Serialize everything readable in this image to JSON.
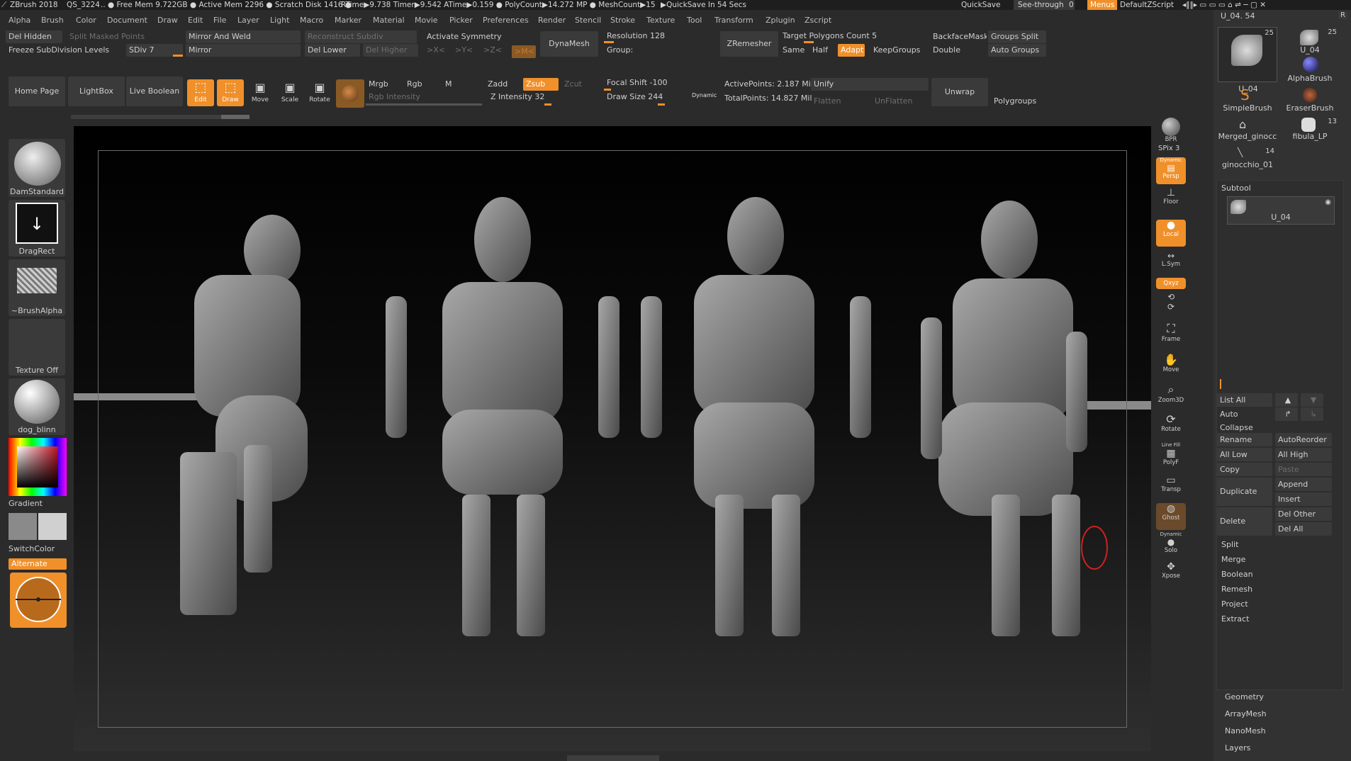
{
  "titlebar": {
    "app": "ZBrush 2018",
    "qs": "QS_3224",
    "stats": ".. ● Free Mem 9.722GB ● Active Mem 2296 ● Scratch Disk 1416 ●",
    "rtime": "RTime▶9.738 Timer▶9.542 ATime▶0.159 ● PolyCount▶14.272 MP ● MeshCount▶15",
    "autosave": "▶QuickSave In 54 Secs",
    "quicksave": "QuickSave",
    "see_through": "See-through",
    "see_through_value": "0",
    "menus": "Menus",
    "zscript": "DefaultZScript"
  },
  "menubar": [
    "Alpha",
    "Brush",
    "Color",
    "Document",
    "Draw",
    "Edit",
    "File",
    "Layer",
    "Light",
    "Macro",
    "Marker",
    "Material",
    "Movie",
    "Picker",
    "Preferences",
    "Render",
    "Stencil",
    "Stroke",
    "Texture",
    "Tool",
    "Transform",
    "Zplugin",
    "Zscript"
  ],
  "toolbar": {
    "del_hidden": "Del Hidden",
    "split_masked": "Split Masked Points",
    "mirror_weld": "Mirror And Weld",
    "reconstruct": "Reconstruct Subdiv",
    "activate_symmetry": "Activate Symmetry",
    "dynamesh": "DynaMesh",
    "resolution": "Resolution 128",
    "group": "Group:",
    "zremesher": "ZRemesher",
    "target_poly": "Target Polygons Count 5",
    "same": "Same",
    "half": "Half",
    "adapt": "Adapt",
    "keepgroups": "KeepGroups",
    "backface": "BackfaceMask",
    "groups_split": "Groups Split",
    "double": "Double",
    "auto_groups": "Auto Groups",
    "freeze": "Freeze SubDivision Levels",
    "sdiv": "SDiv 7",
    "mirror": "Mirror",
    "del_lower": "Del Lower",
    "del_higher": "Del Higher",
    "x": ">X<",
    "y": ">Y<",
    "z": ">Z<",
    "m": ">M<",
    "home": "Home Page",
    "lightbox": "LightBox",
    "live_boolean": "Live Boolean",
    "edit": "Edit",
    "draw": "Draw",
    "move": "Move",
    "scale": "Scale",
    "rotate": "Rotate",
    "mrgb": "Mrgb",
    "rgb": "Rgb",
    "m_btn": "M",
    "zadd": "Zadd",
    "zsub": "Zsub",
    "zcut": "Zcut",
    "rgb_intensity": "Rgb Intensity",
    "z_intensity": "Z Intensity 32",
    "focal_shift": "Focal Shift -100",
    "draw_size": "Draw Size 244",
    "dynamic": "Dynamic",
    "active_points": "ActivePoints: 2.187 Mil",
    "total_points": "TotalPoints: 14.827 Mil",
    "unify": "Unify",
    "flatten": "Flatten",
    "unflatten": "UnFlatten",
    "unwrap": "Unwrap",
    "polygroups": "Polygroups"
  },
  "left": {
    "brush": "DamStandard",
    "stroke": "DragRect",
    "alpha": "~BrushAlpha",
    "texture": "Texture Off",
    "material": "dog_blinn",
    "gradient": "Gradient",
    "switchcolor": "SwitchColor",
    "alternate": "Alternate"
  },
  "rightshelf": {
    "bpr": "BPR",
    "spix": "SPix 3",
    "dynamic": "Dynamic",
    "persp": "Persp",
    "floor": "Floor",
    "local": "Local",
    "lsym": "L.Sym",
    "xyz": "Qxyz",
    "frame": "Frame",
    "move": "Move",
    "zoom3d": "Zoom3D",
    "rotate": "Rotate",
    "polyf": "PolyF",
    "linefill": "Line Fill",
    "transp": "Transp",
    "ghost": "Ghost",
    "solo": "Solo",
    "dynamic2": "Dynamic",
    "xpose": "Xpose"
  },
  "toolpanel": {
    "current": "U_04. 54",
    "r": "R",
    "tools": [
      {
        "name": "U_04",
        "count": "25"
      },
      {
        "name": "U_04",
        "count": "25"
      },
      {
        "name": "AlphaBrush",
        "count": ""
      },
      {
        "name": "SimpleBrush",
        "count": ""
      },
      {
        "name": "EraserBrush",
        "count": ""
      },
      {
        "name": "Merged_ginocc",
        "count": ""
      },
      {
        "name": "fibula_LP",
        "count": "13"
      },
      {
        "name": "ginocchio_01",
        "count": "14"
      }
    ],
    "subtool_header": "Subtool",
    "subtool_item": "U_04",
    "list_all": "List All",
    "auto_collapse": "Auto Collapse",
    "rename": "Rename",
    "autoreorder": "AutoReorder",
    "all_low": "All Low",
    "all_high": "All High",
    "copy": "Copy",
    "paste": "Paste",
    "duplicate": "Duplicate",
    "append": "Append",
    "insert": "Insert",
    "delete": "Delete",
    "del_other": "Del Other",
    "del_all": "Del All",
    "split": "Split",
    "merge": "Merge",
    "boolean": "Boolean",
    "remesh": "Remesh",
    "project": "Project",
    "extract": "Extract",
    "geometry": "Geometry",
    "arraymesh": "ArrayMesh",
    "nanomesh": "NanoMesh",
    "layers": "Layers"
  },
  "colors": {
    "accent": "#f0902a",
    "bg": "#2b2b2b",
    "button": "#3a3a3a"
  }
}
